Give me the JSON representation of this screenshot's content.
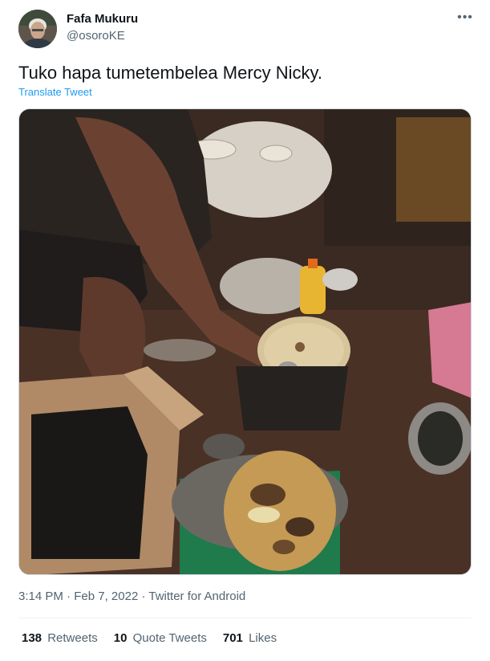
{
  "author": {
    "name": "Fafa Mukuru",
    "handle": "@osoroKE"
  },
  "more_icon": "more-horizontal-icon",
  "tweet": {
    "text": "Tuko hapa tumetembelea Mercy Nicky.",
    "translate_label": "Translate Tweet"
  },
  "meta": {
    "time": "3:14 PM",
    "sep1": "·",
    "date": "Feb 7, 2022",
    "sep2": "·",
    "source": "Twitter for Android"
  },
  "stats": {
    "retweets_count": "138",
    "retweets_label": "Retweets",
    "quotes_count": "10",
    "quotes_label": "Quote Tweets",
    "likes_count": "701",
    "likes_label": "Likes"
  },
  "colors": {
    "link": "#1d9bf0",
    "secondary": "#536471",
    "primary": "#0f1419"
  }
}
